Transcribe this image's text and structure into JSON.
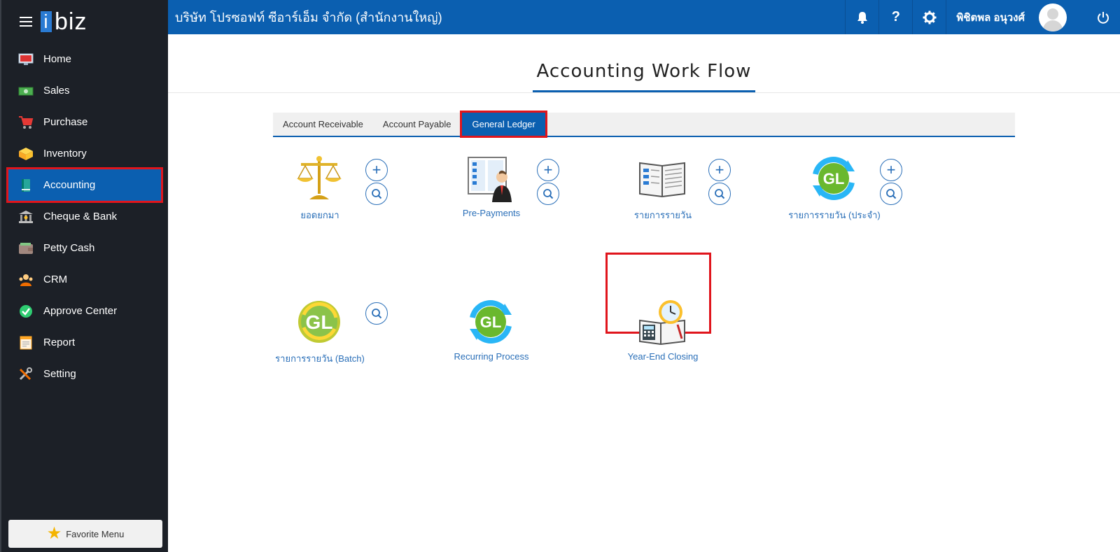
{
  "brand": {
    "logo_i": "i",
    "logo_rest": "biz"
  },
  "header": {
    "company": "บริษัท โปรซอฟท์ ซีอาร์เอ็ม จำกัด (สำนักงานใหญ่)",
    "user_name": "พิชิตพล อนุวงศ์",
    "icons": [
      "bell-icon",
      "help-icon",
      "gear-icon",
      "avatar",
      "power-icon"
    ]
  },
  "sidebar": {
    "items": [
      {
        "label": "Home",
        "icon": "monitor-icon"
      },
      {
        "label": "Sales",
        "icon": "cash-icon"
      },
      {
        "label": "Purchase",
        "icon": "cart-icon"
      },
      {
        "label": "Inventory",
        "icon": "box-icon"
      },
      {
        "label": "Accounting",
        "icon": "ledger-book-icon",
        "active": true
      },
      {
        "label": "Cheque & Bank",
        "icon": "bank-icon"
      },
      {
        "label": "Petty Cash",
        "icon": "wallet-icon"
      },
      {
        "label": "CRM",
        "icon": "people-icon"
      },
      {
        "label": "Approve Center",
        "icon": "check-circle-icon"
      },
      {
        "label": "Report",
        "icon": "report-icon"
      },
      {
        "label": "Setting",
        "icon": "tools-icon"
      }
    ],
    "favorite_label": "Favorite Menu"
  },
  "main": {
    "title": "Accounting Work Flow",
    "tabs": [
      {
        "label": "Account Receivable"
      },
      {
        "label": "Account Payable"
      },
      {
        "label": "General Ledger",
        "active": true
      }
    ],
    "tiles": [
      {
        "label": "ยอดยกมา",
        "icon": "scale-icon",
        "buttons": [
          "add",
          "search"
        ]
      },
      {
        "label": "Pre-Payments",
        "icon": "businessman-board-icon",
        "buttons": [
          "add",
          "search"
        ]
      },
      {
        "label": "รายการรายวัน",
        "icon": "open-journal-icon",
        "buttons": [
          "add",
          "search"
        ]
      },
      {
        "label": "รายการรายวัน (ประจำ)",
        "icon": "gl-recurring-icon",
        "buttons": [
          "add",
          "search"
        ]
      },
      {
        "label": "รายการรายวัน (Batch)",
        "icon": "gl-batch-icon",
        "buttons": [
          "search"
        ]
      },
      {
        "label": "Recurring Process",
        "icon": "gl-recurring-icon",
        "buttons": []
      },
      {
        "label": "Year-End Closing",
        "icon": "year-end-closing-icon",
        "buttons": [],
        "highlighted": true
      }
    ]
  },
  "colors": {
    "primary": "#0b5fb0",
    "sidebar_bg": "#1c2027",
    "highlight": "#e0151c",
    "link": "#2a6fb8"
  }
}
